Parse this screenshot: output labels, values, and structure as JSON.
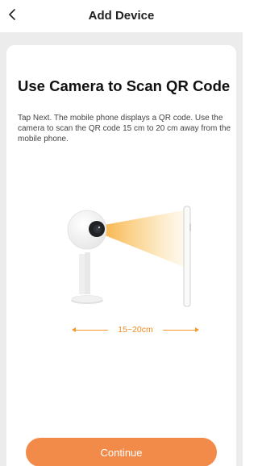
{
  "header": {
    "title": "Add Device",
    "back_icon": "chevron-left-icon"
  },
  "card": {
    "title": "Use Camera to Scan QR Code",
    "description": "Tap Next. The mobile phone displays a QR code. Use the camera to scan the QR code 15 cm to 20 cm away from the mobile phone."
  },
  "illustration": {
    "camera_icon": "camera-icon",
    "phone_icon": "phone-icon",
    "distance_label": "15~20cm"
  },
  "footer": {
    "continue_label": "Continue"
  },
  "colors": {
    "accent": "#f28a4a",
    "distance": "#f08a1c",
    "background": "#ececec"
  }
}
